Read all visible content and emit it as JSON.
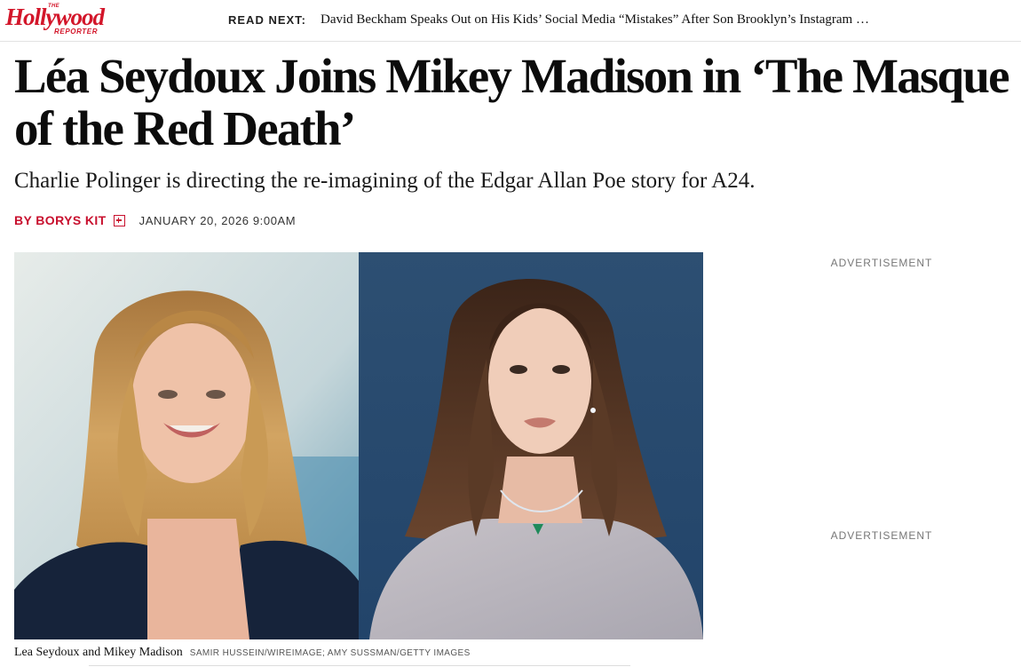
{
  "brand": {
    "logo_small": "THE",
    "logo_word": "Hollywood",
    "logo_sub": "REPORTER",
    "color": "#d3162a"
  },
  "read_next": {
    "label": "READ NEXT:",
    "headline": "David Beckham Speaks Out on His Kids’ Social Media “Mistakes” After Son Brooklyn’s Instagram …"
  },
  "article": {
    "title": "Léa Seydoux Joins Mikey Madison in ‘The Masque of the Red Death’",
    "dek": "Charlie Polinger is directing the re-imagining of the Edgar Allan Poe story for A24.",
    "author": "BY BORYS KIT",
    "date": "JANUARY 20, 2026 9:00AM",
    "author_color": "#c8102e"
  },
  "hero": {
    "caption": "Lea Seydoux and Mikey Madison",
    "credit": "SAMIR HUSSEIN/WIREIMAGE; AMY SUSSMAN/GETTY IMAGES"
  },
  "ads": {
    "label_1": "ADVERTISEMENT",
    "label_2": "ADVERTISEMENT"
  },
  "icons": {
    "follow": "follow-plus-icon"
  }
}
